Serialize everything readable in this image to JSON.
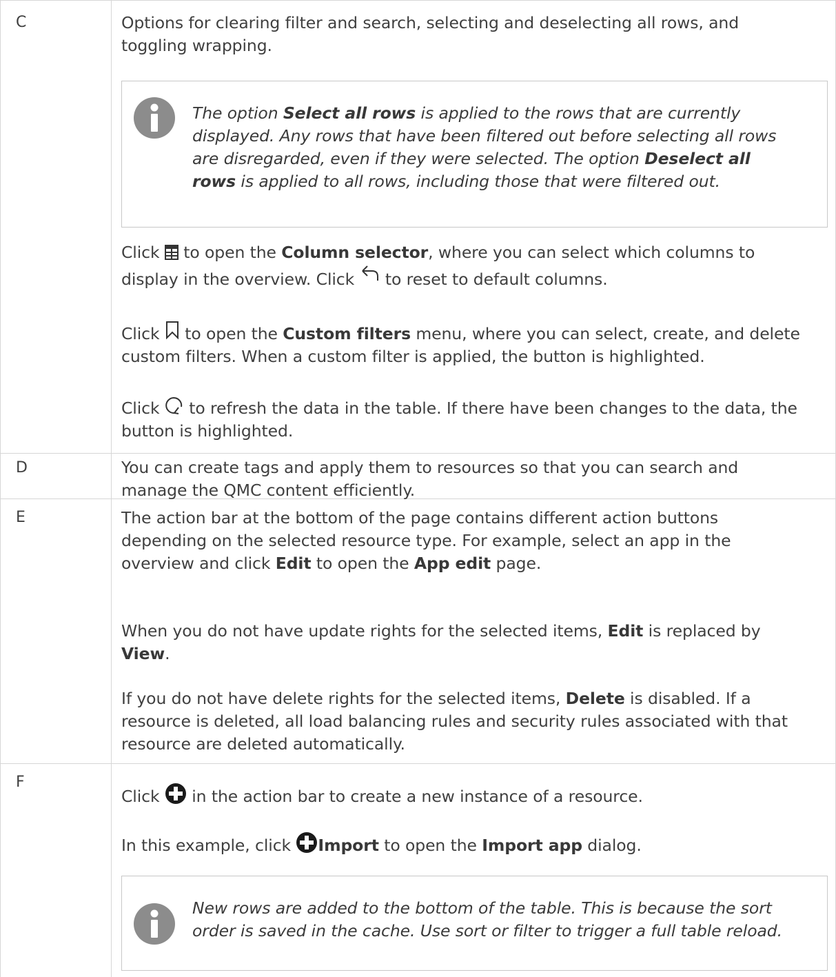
{
  "rows": [
    {
      "key": "C",
      "p1": {
        "line1": "Options for clearing filter and search, selecting and deselecting all rows, and",
        "line2": "toggling wrapping."
      },
      "note": {
        "l1_a": "The option ",
        "l1_b": "Select all rows",
        "l1_c": " is applied to the rows that are currently",
        "l2": "displayed. Any rows that have been filtered out before selecting all rows",
        "l3_a": "are disregarded, even if they were selected. The option ",
        "l3_b": "Deselect all",
        "l4_a": "rows",
        "l4_b": " is applied to all rows, including those that were filtered out."
      },
      "p2": {
        "a": "Click ",
        "icon": "column-selector-icon",
        "b": " to open the ",
        "c": "Column selector",
        "d": ", where you can select which columns to",
        "e": "display in the overview. Click ",
        "icon2": "reset-arrow-icon",
        "f": " to reset to default columns."
      },
      "p3": {
        "a": "Click ",
        "icon": "bookmark-icon",
        "b": " to open the ",
        "c": "Custom filters",
        "d": " menu, where you can select, create, and delete",
        "e": "custom filters. When a custom filter is applied, the button is highlighted."
      },
      "p4": {
        "a": "Click ",
        "icon": "refresh-icon",
        "b": " to refresh the data in the table. If there have been changes to the data, the",
        "c": "button is highlighted."
      }
    },
    {
      "key": "D",
      "line1": "You can create tags and apply them to resources so that you can search and",
      "line2": "manage the QMC content efficiently."
    },
    {
      "key": "E",
      "p1": {
        "line1": "The action bar at the bottom of the page contains different action buttons",
        "line2": "depending on the selected resource type. For example, select an app in the",
        "l3_a": "overview and click ",
        "l3_b": "Edit",
        "l3_c": " to open the ",
        "l3_d": "App edit",
        "l3_e": " page."
      },
      "p2": {
        "a": "When you do not have update rights for the selected items, ",
        "b": "Edit",
        "c": " is replaced by",
        "d": "View",
        "e": "."
      },
      "p3": {
        "a": "If you do not have delete rights for the selected items, ",
        "b": "Delete",
        "c": " is disabled. If a",
        "line2": "resource is deleted, all load balancing rules and security rules associated with that",
        "line3": "resource are deleted automatically."
      }
    },
    {
      "key": "F",
      "p1": {
        "a": "Click ",
        "icon": "plus-circle-icon",
        "b": " in the action bar to create a new instance of a resource."
      },
      "p2": {
        "a": "In this example, click ",
        "icon": "plus-circle-icon",
        "b": "Import",
        "c": " to open the ",
        "d": "Import app",
        "e": " dialog."
      },
      "note": {
        "line1": "New rows are added to the bottom of the table. This is because the sort",
        "line2": "order is saved in the cache. Use sort or filter to trigger a full table reload."
      }
    }
  ],
  "colors": {
    "border": "#d6d6d6",
    "text": "#404040",
    "info_icon": "#8c8c8c"
  }
}
